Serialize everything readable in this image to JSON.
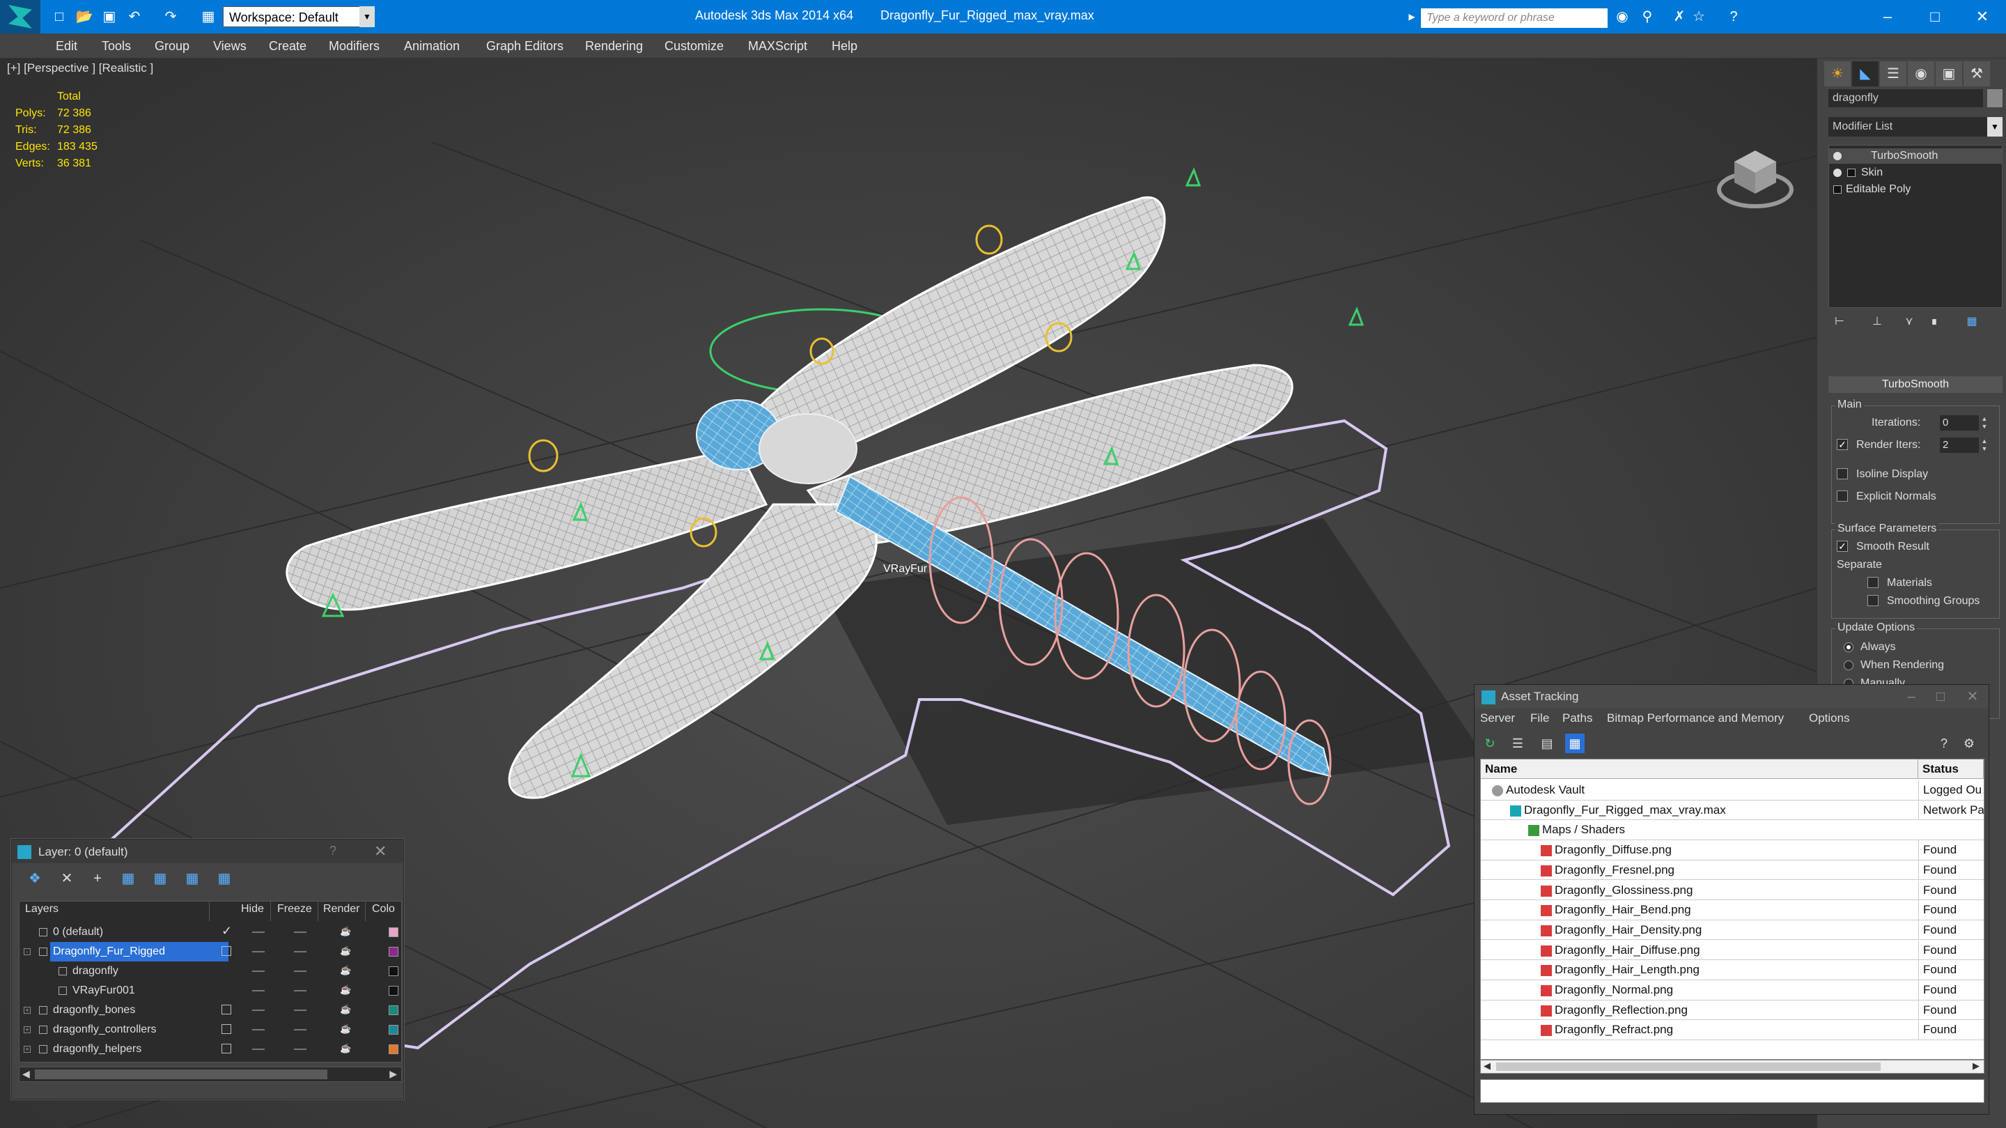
{
  "titlebar": {
    "workspace": "Workspace: Default",
    "app_name": "Autodesk 3ds Max  2014 x64",
    "file_name": "Dragonfly_Fur_Rigged_max_vray.max",
    "search_placeholder": "Type a keyword or phrase",
    "accent": "#0078d7"
  },
  "menu": [
    "Edit",
    "Tools",
    "Group",
    "Views",
    "Create",
    "Modifiers",
    "Animation",
    "Graph Editors",
    "Rendering",
    "Customize",
    "MAXScript",
    "Help"
  ],
  "viewport": {
    "label": "[+] [Perspective ] [Realistic ]",
    "stats": {
      "header": "Total",
      "rows": [
        {
          "label": "Polys:",
          "value": "72 386"
        },
        {
          "label": "Tris:",
          "value": "72 386"
        },
        {
          "label": "Edges:",
          "value": "183 435"
        },
        {
          "label": "Verts:",
          "value": "36 381"
        }
      ]
    },
    "fur_label": "VRayFur"
  },
  "command_panel": {
    "object_name": "dragonfly",
    "modifier_list": "Modifier List",
    "stack": [
      "TurboSmooth",
      "Skin",
      "Editable Poly"
    ],
    "rollout_title": "TurboSmooth",
    "main_group": "Main",
    "iterations_label": "Iterations:",
    "iterations_value": "0",
    "render_iters_label": "Render Iters:",
    "render_iters_value": "2",
    "render_iters_checked": true,
    "isoline_label": "Isoline Display",
    "explicit_normals_label": "Explicit Normals",
    "surface_group": "Surface Parameters",
    "smooth_result_label": "Smooth Result",
    "separate_label": "Separate",
    "materials_label": "Materials",
    "smoothing_groups_label": "Smoothing Groups",
    "update_group": "Update Options",
    "update_options": [
      "Always",
      "When Rendering",
      "Manually"
    ],
    "update_selected": "Always"
  },
  "layer_dialog": {
    "title": "Layer: 0 (default)",
    "columns": [
      "Layers",
      "Hide",
      "Freeze",
      "Render",
      "Colo"
    ],
    "rows": [
      {
        "name": "0 (default)",
        "color": "#e6a6c8"
      },
      {
        "name": "Dragonfly_Fur_Rigged",
        "color": "#8a2a8a"
      },
      {
        "name": "dragonfly",
        "color": "#111111"
      },
      {
        "name": "VRayFur001",
        "color": "#111111"
      },
      {
        "name": "dragonfly_bones",
        "color": "#1a8a7a"
      },
      {
        "name": "dragonfly_controllers",
        "color": "#1a8a9a"
      },
      {
        "name": "dragonfly_helpers",
        "color": "#e07a2a"
      }
    ]
  },
  "asset_dialog": {
    "title": "Asset Tracking",
    "menu": [
      "Server",
      "File",
      "Paths",
      "Bitmap Performance and Memory",
      "Options"
    ],
    "columns": [
      "Name",
      "Status"
    ],
    "rows": [
      {
        "name": "Autodesk Vault",
        "status": "Logged Ou",
        "level": 0,
        "icon": "vault"
      },
      {
        "name": "Dragonfly_Fur_Rigged_max_vray.max",
        "status": "Network Pa",
        "level": 1,
        "icon": "max"
      },
      {
        "name": "Maps / Shaders",
        "status": "",
        "level": 2,
        "icon": "folder"
      },
      {
        "name": "Dragonfly_Diffuse.png",
        "status": "Found",
        "level": 3,
        "icon": "png"
      },
      {
        "name": "Dragonfly_Fresnel.png",
        "status": "Found",
        "level": 3,
        "icon": "png"
      },
      {
        "name": "Dragonfly_Glossiness.png",
        "status": "Found",
        "level": 3,
        "icon": "png"
      },
      {
        "name": "Dragonfly_Hair_Bend.png",
        "status": "Found",
        "level": 3,
        "icon": "png"
      },
      {
        "name": "Dragonfly_Hair_Density.png",
        "status": "Found",
        "level": 3,
        "icon": "png"
      },
      {
        "name": "Dragonfly_Hair_Diffuse.png",
        "status": "Found",
        "level": 3,
        "icon": "png"
      },
      {
        "name": "Dragonfly_Hair_Length.png",
        "status": "Found",
        "level": 3,
        "icon": "png"
      },
      {
        "name": "Dragonfly_Normal.png",
        "status": "Found",
        "level": 3,
        "icon": "png"
      },
      {
        "name": "Dragonfly_Reflection.png",
        "status": "Found",
        "level": 3,
        "icon": "png"
      },
      {
        "name": "Dragonfly_Refract.png",
        "status": "Found",
        "level": 3,
        "icon": "png"
      }
    ]
  }
}
